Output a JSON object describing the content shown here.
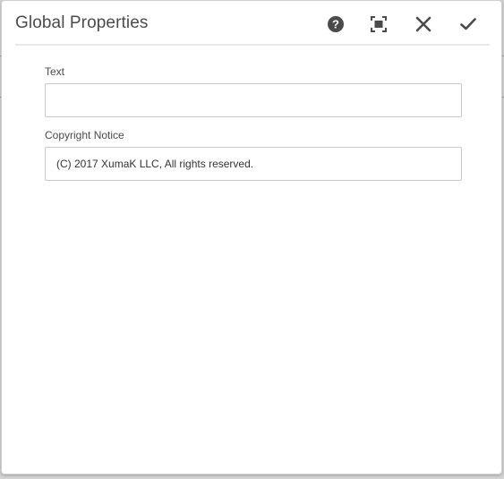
{
  "dialog": {
    "title": "Global Properties",
    "actions": {
      "help_icon": "help-icon",
      "fullscreen_icon": "fullscreen-icon",
      "close_icon": "close-icon",
      "done_icon": "check-icon"
    }
  },
  "form": {
    "text_field": {
      "label": "Text",
      "value": ""
    },
    "copyright_field": {
      "label": "Copyright Notice",
      "value": "(C) 2017 XumaK LLC, All rights reserved."
    }
  },
  "colors": {
    "icon": "#4b4b4b",
    "title": "#4b4b4b",
    "border": "#c9c9c9"
  }
}
